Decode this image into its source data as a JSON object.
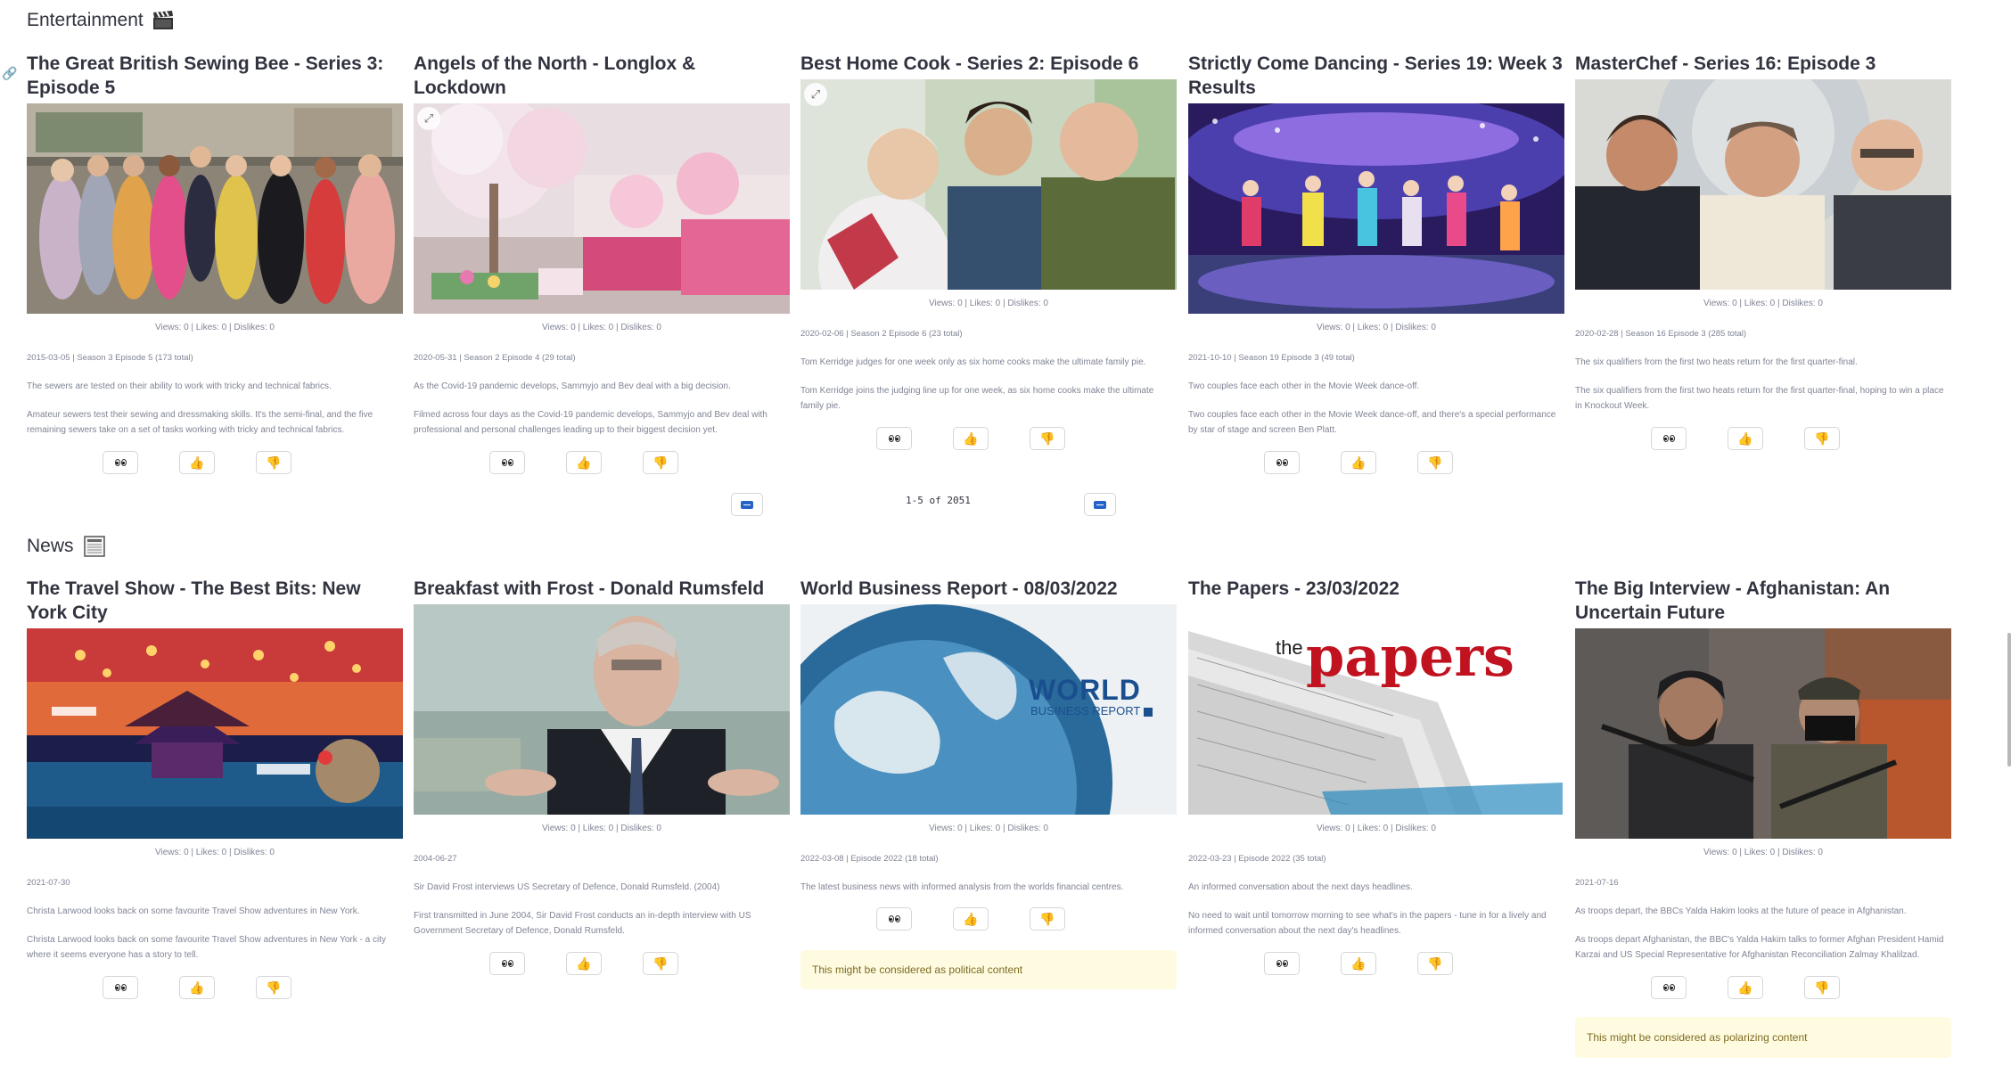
{
  "sections": {
    "entertainment": {
      "title": "Entertainment",
      "icon": "clapper-board-icon"
    },
    "news": {
      "title": "News",
      "icon": "newspaper-icon"
    }
  },
  "entertainment": [
    {
      "title": "The Great British Sewing Bee - Series 3: Episode 5",
      "stats": "Views: 0 | Likes: 0 | Dislikes: 0",
      "meta": "2015-03-05 | Season 3 Episode 5 (173 total)",
      "short": "The sewers are tested on their ability to work with tricky and technical fabrics.",
      "long": "Amateur sewers test their sewing and dressmaking skills. It's the semi-final, and the five remaining sewers take on a set of tasks working with tricky and technical fabrics."
    },
    {
      "title": "Angels of the North - Longlox & Lockdown",
      "stats": "Views: 0 | Likes: 0 | Dislikes: 0",
      "meta": "2020-05-31 | Season 2 Episode 4 (29 total)",
      "short": "As the Covid-19 pandemic develops, Sammyjo and Bev deal with a big decision.",
      "long": "Filmed across four days as the Covid-19 pandemic develops, Sammyjo and Bev deal with professional and personal challenges leading up to their biggest decision yet."
    },
    {
      "title": "Best Home Cook - Series 2: Episode 6",
      "stats": "Views: 0 | Likes: 0 | Dislikes: 0",
      "meta": "2020-02-06 | Season 2 Episode 6 (23 total)",
      "short": "Tom Kerridge judges for one week only as six home cooks make the ultimate family pie.",
      "long": "Tom Kerridge joins the judging line up for one week, as six home cooks make the ultimate family pie."
    },
    {
      "title": "Strictly Come Dancing - Series 19: Week 3 Results",
      "stats": "Views: 0 | Likes: 0 | Dislikes: 0",
      "meta": "2021-10-10 | Season 19 Episode 3 (49 total)",
      "short": "Two couples face each other in the Movie Week dance-off.",
      "long": "Two couples face each other in the Movie Week dance-off, and there's a special performance by star of stage and screen Ben Platt."
    },
    {
      "title": "MasterChef - Series 16: Episode 3",
      "stats": "Views: 0 | Likes: 0 | Dislikes: 0",
      "meta": "2020-02-28 | Season 16 Episode 3 (285 total)",
      "short": "The six qualifiers from the first two heats return for the first quarter-final.",
      "long": "The six qualifiers from the first two heats return for the first quarter-final, hoping to win a place in Knockout Week."
    }
  ],
  "pager": {
    "text": "1-5 of 2051"
  },
  "news": [
    {
      "title": "The Travel Show - The Best Bits: New York City",
      "stats": "Views: 0 | Likes: 0 | Dislikes: 0",
      "meta": "2021-07-30",
      "short": "Christa Larwood looks back on some favourite Travel Show adventures in New York.",
      "long": "Christa Larwood looks back on some favourite Travel Show adventures in New York - a city where it seems everyone has a story to tell."
    },
    {
      "title": "Breakfast with Frost - Donald Rumsfeld",
      "stats": "Views: 0 | Likes: 0 | Dislikes: 0",
      "meta": "2004-06-27",
      "short": "Sir David Frost interviews US Secretary of Defence, Donald Rumsfeld. (2004)",
      "long": "First transmitted in June 2004, Sir David Frost conducts an in-depth interview with US Government Secretary of Defence, Donald Rumsfeld."
    },
    {
      "title": "World Business Report - 08/03/2022",
      "stats": "Views: 0 | Likes: 0 | Dislikes: 0",
      "meta": "2022-03-08 | Episode 2022 (18 total)",
      "short": "The latest business news with informed analysis from the worlds financial centres.",
      "warning": "This might be considered as political content",
      "logo_line1": "WORLD",
      "logo_line2": "BUSINESS REPORT"
    },
    {
      "title": "The Papers - 23/03/2022",
      "stats": "Views: 0 | Likes: 0 | Dislikes: 0",
      "meta": "2022-03-23 | Episode 2022 (35 total)",
      "short": "An informed conversation about the next days headlines.",
      "long": "No need to wait until tomorrow morning to see what's in the papers - tune in for a lively and informed conversation about the next day's headlines.",
      "logo_the": "the",
      "logo_papers": "papers"
    },
    {
      "title": "The Big Interview - Afghanistan: An Uncertain Future",
      "stats": "Views: 0 | Likes: 0 | Dislikes: 0",
      "meta": "2021-07-16",
      "short": "As troops depart, the BBCs Yalda Hakim looks at the future of peace in Afghanistan.",
      "long": "As troops depart Afghanistan, the BBC's Yalda Hakim talks to former Afghan President Hamid Karzai and US Special Representative for Afghanistan Reconciliation Zalmay Khalilzad.",
      "warning": "This might be considered as polarizing content"
    }
  ]
}
